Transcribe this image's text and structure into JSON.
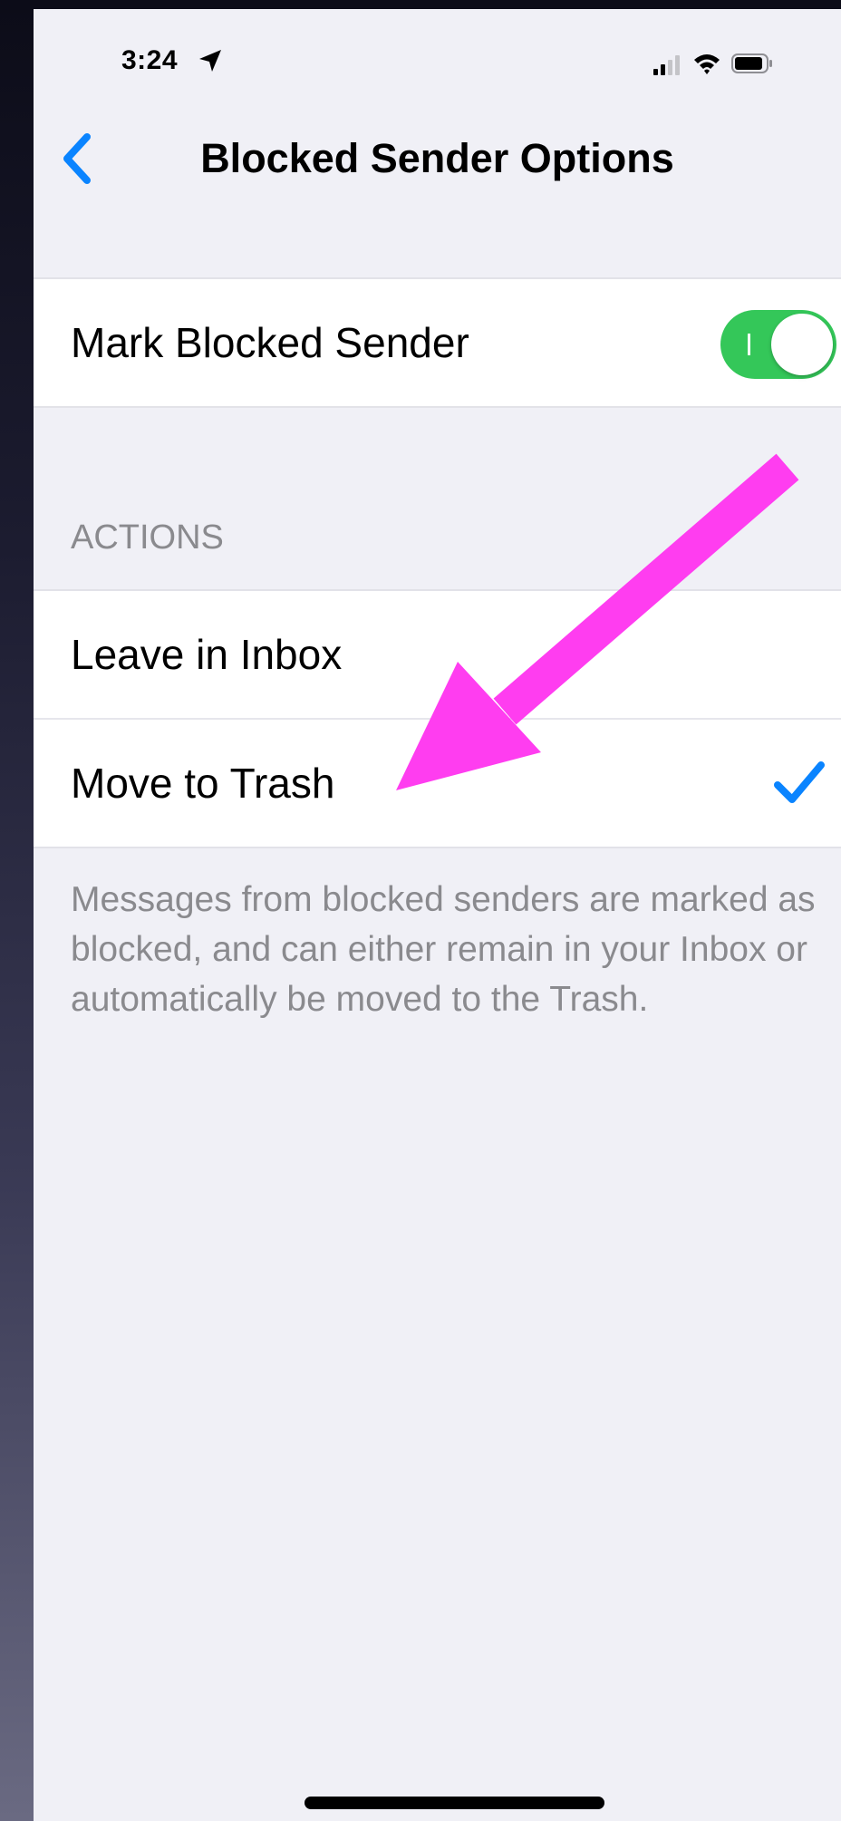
{
  "status_bar": {
    "time": "3:24",
    "icons": [
      "location-arrow-icon",
      "signal-icon",
      "wifi-icon",
      "battery-icon"
    ]
  },
  "nav": {
    "back_icon": "chevron-left-icon",
    "title": "Blocked Sender Options"
  },
  "mark_blocked": {
    "label": "Mark Blocked Sender",
    "toggle_on": true
  },
  "actions": {
    "header": "ACTIONS",
    "options": [
      {
        "label": "Leave in Inbox",
        "selected": false
      },
      {
        "label": "Move to Trash",
        "selected": true
      }
    ],
    "footer": "Messages from blocked senders are marked as blocked, and can either remain in your Inbox or automatically be moved to the Trash."
  },
  "annotation": {
    "type": "arrow",
    "color": "#ff3df0",
    "points_to": "Move to Trash"
  },
  "colors": {
    "accent": "#0a84ff",
    "toggle_on": "#34c759",
    "background": "#f0f0f6",
    "secondary_text": "#8a8a8e"
  }
}
